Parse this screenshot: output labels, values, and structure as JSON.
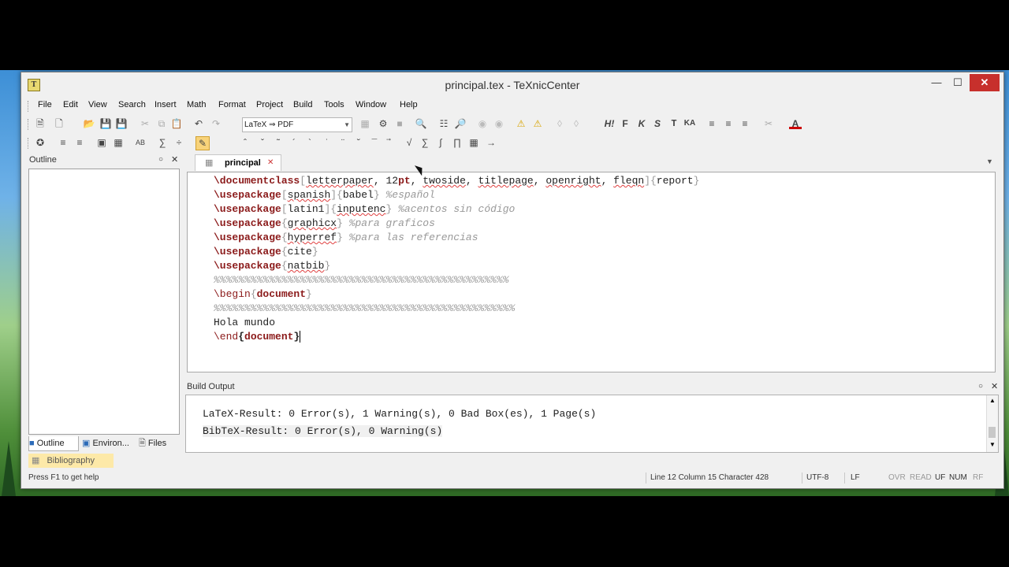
{
  "window": {
    "title": "principal.tex - TeXnicCenter",
    "app_icon": "T"
  },
  "menu": [
    "File",
    "Edit",
    "View",
    "Search",
    "Insert",
    "Math",
    "Format",
    "Project",
    "Build",
    "Tools",
    "Window",
    "Help"
  ],
  "toolbar": {
    "combo_value": "LaTeX ⇒ PDF"
  },
  "outline": {
    "title": "Outline"
  },
  "bottom_tabs": [
    "Outline",
    "Environ...",
    "Files"
  ],
  "bibliography_label": "Bibliography",
  "document_tab": {
    "label": "principal"
  },
  "editor_lines": [
    "\\documentclass[letterpaper, 12pt, twoside, titlepage, openright, fleqn]{report}",
    "\\usepackage[spanish]{babel} %español",
    "\\usepackage[latin1]{inputenc} %acentos sin código",
    "\\usepackage{graphicx} %para graficos",
    "\\usepackage{hyperref} %para las referencias",
    "\\usepackage{cite}",
    "\\usepackage{natbib}",
    "%%%%%%%%%%%%%%%%%%%%%%%%%%%%%%%%%%%%%%%%%%%%%%%%",
    "\\begin{document}",
    "%%%%%%%%%%%%%%%%%%%%%%%%%%%%%%%%%%%%%%%%%%%%%%%%%",
    "Hola mundo",
    "\\end{document}"
  ],
  "build_output": {
    "title": "Build Output",
    "lines": [
      "LaTeX-Result: 0 Error(s), 1 Warning(s), 0 Bad Box(es), 1 Page(s)",
      "BibTeX-Result: 0 Error(s), 0 Warning(s)"
    ]
  },
  "status": {
    "help": "Press F1 to get help",
    "position": "Line 12 Column 15 Character 428",
    "encoding": "UTF-8",
    "line_ending": "LF",
    "indicators": [
      "OVR",
      "READ",
      "UF",
      "NUM",
      "RF"
    ]
  }
}
